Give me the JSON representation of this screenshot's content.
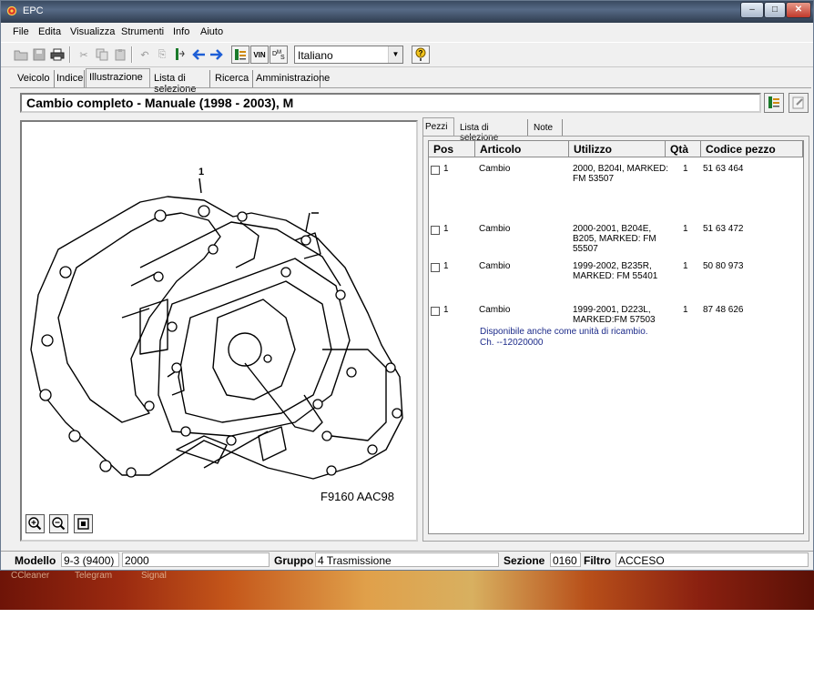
{
  "window": {
    "title": "EPC",
    "min": "–",
    "max": "□",
    "close": "✕"
  },
  "menu": [
    "File",
    "Edita",
    "Visualizza",
    "Strumenti",
    "Info",
    "Aiuto"
  ],
  "toolbar": {
    "vin_label": "VIN",
    "language": "Italiano",
    "help": "?"
  },
  "main_tabs": [
    "Veicolo",
    "Indice",
    "Illustrazione",
    "Lista di selezione",
    "Ricerca",
    "Amministrazione"
  ],
  "active_tab": "Illustrazione",
  "heading": "Cambio completo - Manuale   (1998 - 2003), M",
  "illustration": {
    "callout": "1",
    "code": "F9160 AAC98"
  },
  "sub_tabs": [
    "Pezzi",
    "Lista di selezione",
    "Note"
  ],
  "table": {
    "headers": [
      "Pos",
      "Articolo",
      "Utilizzo",
      "Qtà",
      "Codice pezzo"
    ],
    "rows": [
      {
        "pos": "1",
        "articolo": "Cambio",
        "utilizzo": [
          "2000, B204I,  MARKED:",
          "FM 53507"
        ],
        "qta": "1",
        "codice": "51 63 464"
      },
      {
        "pos": "1",
        "articolo": "Cambio",
        "utilizzo": [
          "2000-2001, B204E,",
          "B205,  MARKED: FM",
          "55507"
        ],
        "qta": "1",
        "codice": "51 63 472"
      },
      {
        "pos": "1",
        "articolo": "Cambio",
        "utilizzo": [
          "1999-2002, B235R,",
          "MARKED: FM 55401"
        ],
        "qta": "1",
        "codice": "50 80 973"
      },
      {
        "pos": "1",
        "articolo": "Cambio",
        "utilizzo": [
          "1999-2001, D223L,",
          "MARKED:FM 57503"
        ],
        "qta": "1",
        "codice": "87 48 626"
      }
    ],
    "note": [
      "Disponibile anche come unità di ricambio.",
      "Ch. --12020000"
    ]
  },
  "status": {
    "modello_label": "Modello",
    "modello": "9-3 (9400)",
    "anno": "2000",
    "gruppo_label": "Gruppo",
    "gruppo": "4 Trasmissione",
    "sezione_label": "Sezione",
    "sezione": "0160",
    "filtro_label": "Filtro",
    "filtro": "ACCESO"
  },
  "desktop": [
    "CCleaner",
    "Telegram",
    "Signal"
  ]
}
